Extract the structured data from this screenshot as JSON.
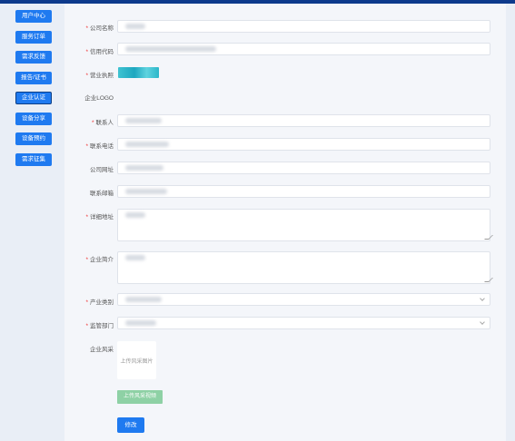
{
  "sidebar": {
    "items": [
      {
        "label": "用户中心",
        "active": false
      },
      {
        "label": "服务订单",
        "active": false
      },
      {
        "label": "需求反馈",
        "active": false
      },
      {
        "label": "报告/证书",
        "active": false
      },
      {
        "label": "企业认证",
        "active": true
      },
      {
        "label": "设备分享",
        "active": false
      },
      {
        "label": "设备预约",
        "active": false
      },
      {
        "label": "需求征集",
        "active": false
      }
    ]
  },
  "form": {
    "company_name": {
      "label": "公司名称",
      "required": true
    },
    "credit_code": {
      "label": "信用代码",
      "required": true
    },
    "business_license": {
      "label": "营业执照",
      "required": true
    },
    "company_logo": {
      "label": "企业LOGO",
      "required": false
    },
    "contact_person": {
      "label": "联系人",
      "required": true
    },
    "contact_phone": {
      "label": "联系电话",
      "required": true
    },
    "website": {
      "label": "公司网址",
      "required": false
    },
    "email": {
      "label": "联系邮箱",
      "required": false
    },
    "address": {
      "label": "详细地址",
      "required": true
    },
    "profile": {
      "label": "企业简介",
      "required": true
    },
    "industry": {
      "label": "产业类别",
      "required": true
    },
    "department": {
      "label": "监管部门",
      "required": true
    },
    "style": {
      "label": "企业风采",
      "required": false
    }
  },
  "upload": {
    "image_label": "上传风采图片",
    "video_label": "上传风采视频"
  },
  "actions": {
    "modify_label": "修改"
  },
  "colors": {
    "primary": "#1f7af0",
    "top_bar": "#0d3a8c",
    "video_button": "#8ed1a5",
    "required_mark": "#e33"
  }
}
